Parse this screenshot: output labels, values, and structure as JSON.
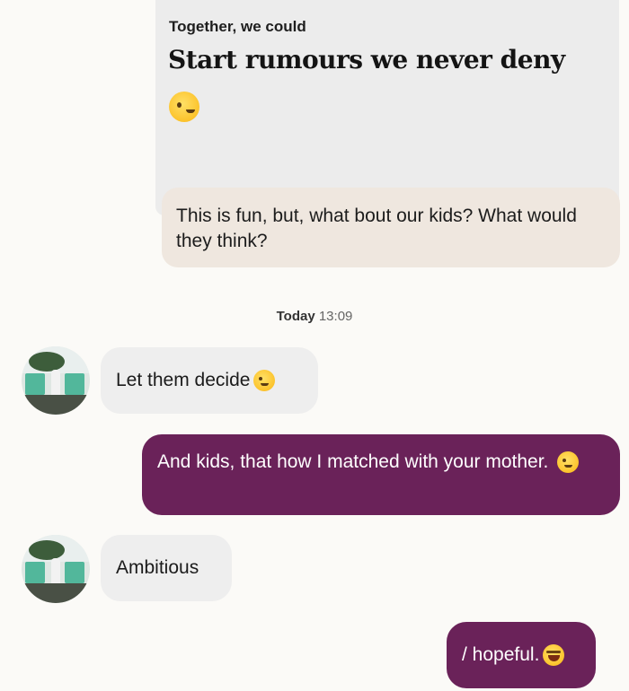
{
  "prompt": {
    "label": "Together, we could",
    "answer": "Start rumours we never deny",
    "emoji": "wink-emoji"
  },
  "reply": {
    "text": "This is fun, but, what bout our kids? What would they think?"
  },
  "timestamp": {
    "day": "Today",
    "time": "13:09"
  },
  "messages": [
    {
      "side": "incoming",
      "text": "Let them decide",
      "emoji": "wink-emoji"
    },
    {
      "side": "outgoing",
      "text": "And kids, that how I matched with your mother.",
      "emoji": "smirk-emoji"
    },
    {
      "side": "incoming",
      "text": "Ambitious"
    },
    {
      "side": "outgoing",
      "text": "/ hopeful.",
      "emoji": "tears-of-joy-emoji"
    }
  ],
  "colors": {
    "background": "#fbfaf7",
    "prompt_card": "#ececec",
    "reply_bubble": "#efe7df",
    "incoming_bubble": "#eeeeee",
    "outgoing_bubble": "#6a2259",
    "outgoing_text": "#ffffff"
  }
}
